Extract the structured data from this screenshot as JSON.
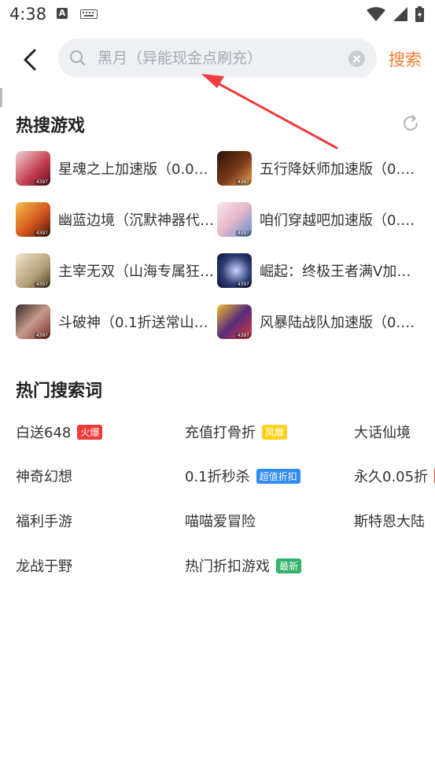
{
  "status_bar": {
    "time": "4:38",
    "a_label": "A"
  },
  "search": {
    "placeholder": "黑月（异能现金点刷充）",
    "button_label": "搜索"
  },
  "hot_games": {
    "title": "热搜游戏",
    "items": [
      {
        "name": "星魂之上加速版（0.05折...",
        "icon_color": "#c2394c"
      },
      {
        "name": "五行降妖师加速版（0.1...",
        "icon_color": "#7a3b1c"
      },
      {
        "name": "幽蓝边境（沉默神器代码...",
        "icon_color": "#d4561e"
      },
      {
        "name": "咱们穿越吧加速版（0.1...",
        "icon_color": "#e6b7c9"
      },
      {
        "name": "主宰无双（山海专属狂暴...",
        "icon_color": "#b4a07a"
      },
      {
        "name": "崛起：终极王者满V加速...",
        "icon_color": "#2c3b72"
      },
      {
        "name": "斗破神（0.1折送常山赵...",
        "icon_color": "#c79a8a"
      },
      {
        "name": "风暴陆战队加速版（0.1...",
        "icon_color": "#5a2a7a"
      }
    ]
  },
  "hot_keywords": {
    "title": "热门搜索词",
    "items": [
      {
        "text": "白送648",
        "tag": "火爆",
        "tag_color": "#f23a3a"
      },
      {
        "text": "充值打骨折",
        "tag": "风靡",
        "tag_color": "#ffd21f"
      },
      {
        "text": "大话仙境"
      },
      {
        "text": "神奇幻想"
      },
      {
        "text": "0.1折秒杀",
        "tag": "超值折扣",
        "tag_color": "#2e8cf0"
      },
      {
        "text": "永久0.05折"
      },
      {
        "text": "福利手游"
      },
      {
        "text": "喵喵爱冒险"
      },
      {
        "text": "斯特恩大陆"
      },
      {
        "text": "龙战于野"
      },
      {
        "text": "热门折扣游戏",
        "tag": "最新",
        "tag_color": "#34b36a"
      }
    ]
  },
  "annotation": {
    "arrow_color": "#f03c3c"
  }
}
